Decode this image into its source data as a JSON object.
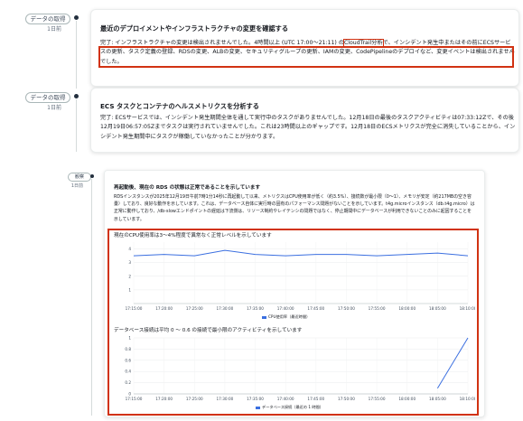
{
  "timeline": [
    {
      "badge": "データの取得",
      "ago": "1日前",
      "title": "最近のデプロイメントやインフラストラクチャの変更を確認する",
      "text_parts": [
        "完了: インフラストラクチャの変更は検出されませんでした。4時間以上 (UTC 17:00〜21:11) の",
        "CloudTrail分析",
        "で、インシデント発生中またはその前にECSサービスの更新、タスク定義の登録、RDSの変更、ALBの変更、セキュリティグループの更新、IAMの変更、CodePipelineのデプロイなど、変更イベントは検出されませんでした。"
      ]
    },
    {
      "badge": "データの取得",
      "ago": "1日前",
      "title": "ECS タスクとコンテナのヘルスメトリクスを分析する",
      "text": "完了: ECSサービスでは、インシデント発生期間全体を通して実行中のタスクがありませんでした。12月18日の最後のタスクアクティビティは07:33:12Zで、その後12月19日06:57:05Zまでタスクは実行されていませんでした。これは23時間以上のギャップです。12月18日のECSメトリクスが完全に消失していることから、インシデント発生期間中にタスクが稼働していなかったことが分かります。"
    },
    {
      "badge": "観察",
      "ago": "1日前",
      "title": "再起動後、現在の RDS の状態は正常であることを示しています",
      "text": "RDSインスタンスが2025年12月19日午前7時1分14秒に再起動して以来、メトリクスはCPU使用率が低く（約3.5%）、接続数が最小限（0〜1）、メモリが安定（約217MBの空き容量）しており、良好な動作を示しています。これは、データベース自体に実行時の固有のパフォーマンス問題がないことを示しています。t4g.microインスタンス（db.t4g.micro）は正常に動作しており、/db-slowエンドポイントの遅延は下流側は、リソース制約やレイテンシの問題ではなく、停止期間中にデータベースが利用できないことのみに起因することを示しています。"
    }
  ],
  "charts_meta": {
    "cpu_chart_title": "現在のCPU使用率は3〜4%程度で異常なく正常レベルを示しています",
    "db_chart_title": "データベース接続は平均 0 〜 0.6 の接続で最小限のアクティビティを示しています",
    "cpu_legend": "CPU使用率（最近時間）",
    "db_legend": "データベース接続（最近の 1 時間）",
    "line_color": "#3b6fe0"
  },
  "chart_data": [
    {
      "type": "line",
      "title": "現在のCPU使用率は3〜4%程度で異常なく正常レベルを示しています",
      "x": [
        "17:15:00",
        "17:20:00",
        "17:25:00",
        "17:30:00",
        "17:35:00",
        "17:40:00",
        "17:45:00",
        "17:50:00",
        "17:55:00",
        "18:00:00",
        "18:05:00",
        "18:10:00"
      ],
      "series": [
        {
          "name": "CPU使用率（最近時間）",
          "values": [
            3.5,
            3.6,
            3.5,
            3.9,
            3.6,
            3.5,
            3.6,
            3.6,
            3.5,
            3.6,
            3.7,
            3.5
          ]
        }
      ],
      "yticks": [
        1,
        2,
        3,
        4
      ],
      "ylim": [
        0,
        4.5
      ],
      "grid": true,
      "legend": "bottom"
    },
    {
      "type": "line",
      "title": "データベース接続は平均 0 〜 0.6 の接続で最小限のアクティビティを示しています",
      "x": [
        "17:15:00",
        "17:20:00",
        "17:25:00",
        "17:30:00",
        "17:35:00",
        "17:40:00",
        "17:45:00",
        "17:50:00",
        "17:55:00",
        "18:00:00",
        "18:05:00",
        "18:10:00"
      ],
      "series": [
        {
          "name": "データベース接続（最近の 1 時間）",
          "points": [
            [
              "18:05:00",
              0.1
            ],
            [
              "18:10:00",
              1.0
            ]
          ]
        }
      ],
      "yticks": [
        0,
        0.2,
        0.4,
        0.6,
        0.8,
        1
      ],
      "ylim": [
        0,
        1
      ],
      "grid": true,
      "legend": "bottom"
    }
  ]
}
